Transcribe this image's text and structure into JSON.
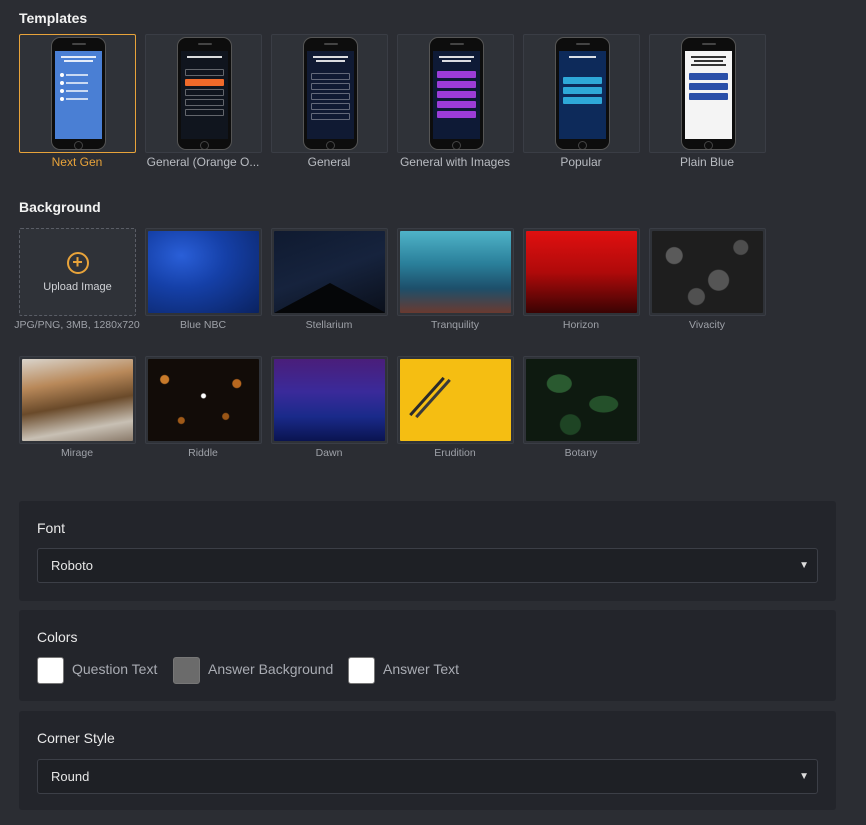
{
  "templates": {
    "title": "Templates",
    "items": [
      {
        "label": "Next Gen",
        "selected": true
      },
      {
        "label": "General (Orange O..."
      },
      {
        "label": "General"
      },
      {
        "label": "General with Images"
      },
      {
        "label": "Popular"
      },
      {
        "label": "Plain Blue"
      }
    ]
  },
  "background": {
    "title": "Background",
    "upload_label": "Upload Image",
    "upload_hint": "JPG/PNG, 3MB, 1280x720",
    "images": [
      "Blue NBC",
      "Stellarium",
      "Tranquility",
      "Horizon",
      "Vivacity",
      "Mirage",
      "Riddle",
      "Dawn",
      "Erudition",
      "Botany"
    ]
  },
  "font": {
    "title": "Font",
    "value": "Roboto"
  },
  "colors": {
    "title": "Colors",
    "question_text": "Question Text",
    "answer_background": "Answer Background",
    "answer_text": "Answer Text",
    "question_text_color": "#ffffff",
    "answer_background_color": "#6b6b6b",
    "answer_text_color": "#ffffff"
  },
  "corner_style": {
    "title": "Corner Style",
    "value": "Round"
  }
}
